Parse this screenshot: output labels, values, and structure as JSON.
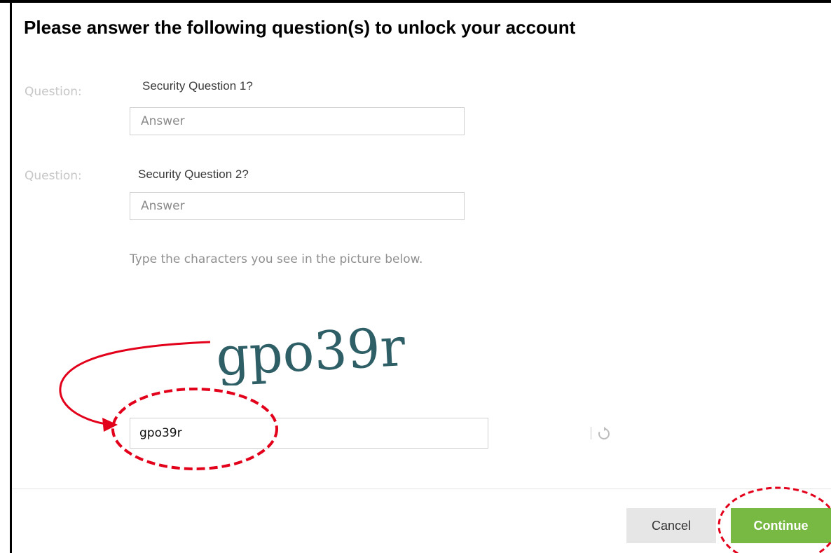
{
  "dialog": {
    "title": "Please answer the following question(s) to unlock your account",
    "questions": [
      {
        "label": "Question:",
        "text": "Security Question 1?",
        "answer_placeholder": "Answer",
        "answer_value": ""
      },
      {
        "label": "Question:",
        "text": "Security Question 2?",
        "answer_placeholder": "Answer",
        "answer_value": ""
      }
    ],
    "captcha": {
      "instruction": "Type the characters you see in the picture below.",
      "image_text": "gpo39r",
      "input_value": "gpo39r",
      "refresh_icon": "refresh-icon"
    },
    "buttons": {
      "cancel_label": "Cancel",
      "continue_label": "Continue"
    }
  },
  "colors": {
    "continue_bg": "#78b943",
    "cancel_bg": "#e6e6e6",
    "annotation_red": "#e2001a",
    "captcha_text": "#2f5f66"
  }
}
